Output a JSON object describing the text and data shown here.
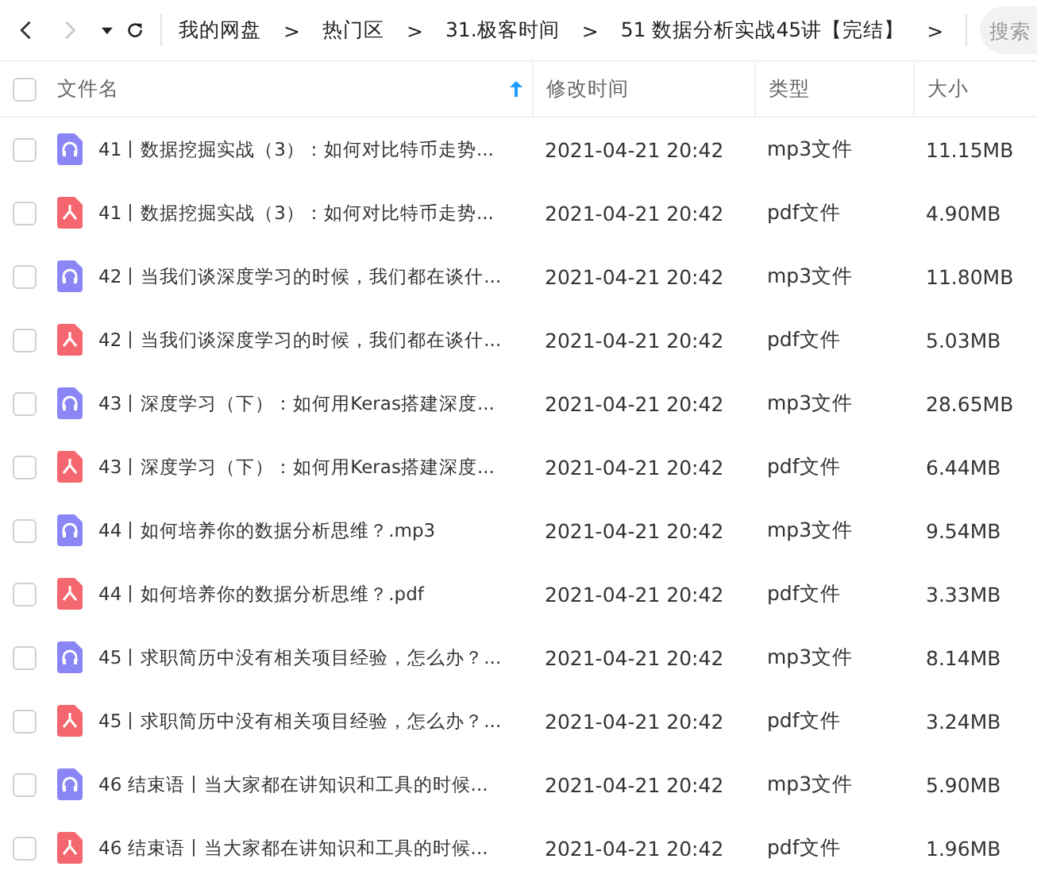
{
  "toolbar": {
    "back_enabled": true,
    "forward_enabled": false,
    "breadcrumb": [
      {
        "label": "我的网盘",
        "sep": ">"
      },
      {
        "label": "热门区",
        "sep": ">"
      },
      {
        "label": "31.极客时间",
        "sep": ">"
      },
      {
        "label": "51 数据分析实战45讲【完结】",
        "sep": ">"
      }
    ],
    "search": {
      "placeholder": "搜索"
    }
  },
  "table": {
    "all_checked": false,
    "columns": [
      {
        "label": "文件名",
        "sorted": true
      },
      {
        "label": "修改时间",
        "sorted": false
      },
      {
        "label": "类型",
        "sorted": false
      },
      {
        "label": "大小",
        "sorted": false
      }
    ],
    "rows": [
      {
        "kind": "audio",
        "checked": false,
        "name": "41丨数据挖掘实战（3）：如何对比特币走势...",
        "time": "2021-04-21 20:42",
        "type": "mp3文件",
        "size": "11.15MB"
      },
      {
        "kind": "pdf",
        "checked": false,
        "name": "41丨数据挖掘实战（3）：如何对比特币走势...",
        "time": "2021-04-21 20:42",
        "type": "pdf文件",
        "size": "4.90MB"
      },
      {
        "kind": "audio",
        "checked": false,
        "name": "42丨当我们谈深度学习的时候，我们都在谈什...",
        "time": "2021-04-21 20:42",
        "type": "mp3文件",
        "size": "11.80MB"
      },
      {
        "kind": "pdf",
        "checked": false,
        "name": "42丨当我们谈深度学习的时候，我们都在谈什...",
        "time": "2021-04-21 20:42",
        "type": "pdf文件",
        "size": "5.03MB"
      },
      {
        "kind": "audio",
        "checked": false,
        "name": "43丨深度学习（下）：如何用Keras搭建深度...",
        "time": "2021-04-21 20:42",
        "type": "mp3文件",
        "size": "28.65MB"
      },
      {
        "kind": "pdf",
        "checked": false,
        "name": "43丨深度学习（下）：如何用Keras搭建深度...",
        "time": "2021-04-21 20:42",
        "type": "pdf文件",
        "size": "6.44MB"
      },
      {
        "kind": "audio",
        "checked": false,
        "name": "44丨如何培养你的数据分析思维？.mp3",
        "time": "2021-04-21 20:42",
        "type": "mp3文件",
        "size": "9.54MB"
      },
      {
        "kind": "pdf",
        "checked": false,
        "name": "44丨如何培养你的数据分析思维？.pdf",
        "time": "2021-04-21 20:42",
        "type": "pdf文件",
        "size": "3.33MB"
      },
      {
        "kind": "audio",
        "checked": false,
        "name": "45丨求职简历中没有相关项目经验，怎么办？...",
        "time": "2021-04-21 20:42",
        "type": "mp3文件",
        "size": "8.14MB"
      },
      {
        "kind": "pdf",
        "checked": false,
        "name": "45丨求职简历中没有相关项目经验，怎么办？...",
        "time": "2021-04-21 20:42",
        "type": "pdf文件",
        "size": "3.24MB"
      },
      {
        "kind": "audio",
        "checked": false,
        "name": "46 结束语丨当大家都在讲知识和工具的时候...",
        "time": "2021-04-21 20:42",
        "type": "mp3文件",
        "size": "5.90MB"
      },
      {
        "kind": "pdf",
        "checked": false,
        "name": "46 结束语丨当大家都在讲知识和工具的时候...",
        "time": "2021-04-21 20:42",
        "type": "pdf文件",
        "size": "1.96MB"
      }
    ]
  }
}
